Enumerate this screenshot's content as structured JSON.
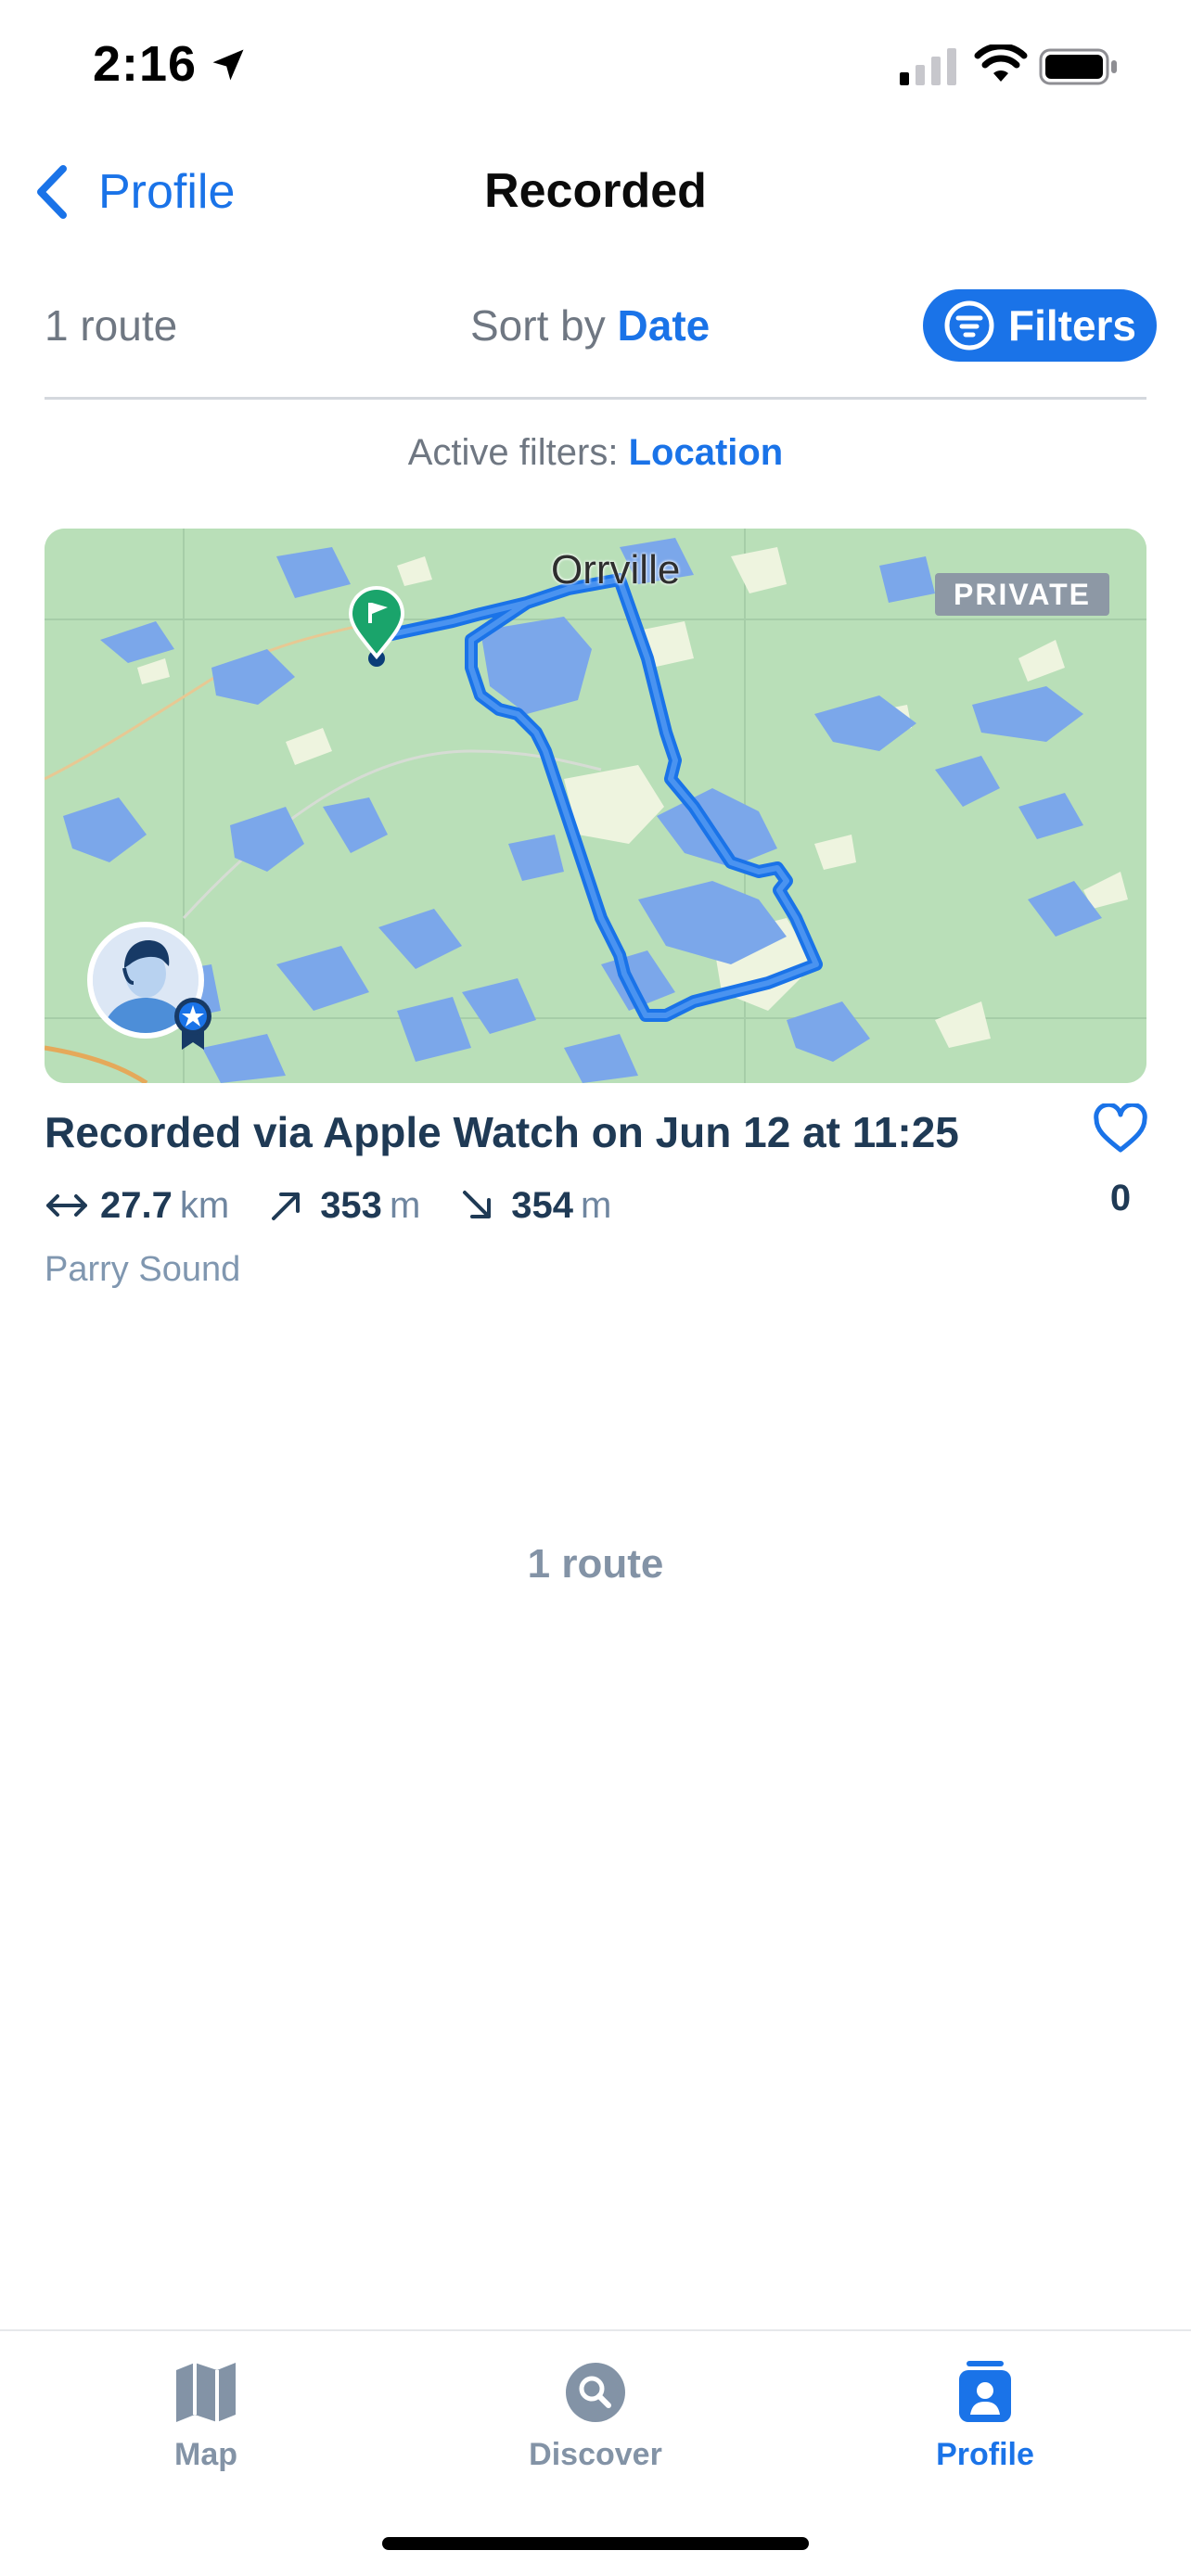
{
  "status_bar": {
    "time": "2:16",
    "icons": [
      "location-arrow-icon",
      "cellular-signal-icon",
      "wifi-icon",
      "battery-icon"
    ]
  },
  "nav": {
    "back_label": "Profile",
    "title": "Recorded"
  },
  "toolbar": {
    "route_count": "1 route",
    "sort_prefix": "Sort by",
    "sort_value": "Date",
    "filters_label": "Filters"
  },
  "active_filters": {
    "prefix": "Active filters:",
    "value": "Location"
  },
  "route": {
    "map_town_label": "Orrville",
    "privacy_badge": "PRIVATE",
    "title": "Recorded via Apple Watch on Jun 12 at 11:25",
    "distance_value": "27.7",
    "distance_unit": "km",
    "ascent_value": "353",
    "ascent_unit": "m",
    "descent_value": "354",
    "descent_unit": "m",
    "location": "Parry Sound",
    "likes": "0"
  },
  "list_footer": {
    "count": "1 route"
  },
  "tabs": [
    {
      "label": "Map",
      "icon": "map-icon",
      "active": false
    },
    {
      "label": "Discover",
      "icon": "search-icon",
      "active": false
    },
    {
      "label": "Profile",
      "icon": "profile-icon",
      "active": true
    }
  ],
  "colors": {
    "accent": "#1a73e8",
    "text_dark": "#1f3a55",
    "text_muted": "#6f7782",
    "map_land": "#b9dfb8",
    "map_water": "#7ba7ea",
    "route_line": "#1a73e8",
    "badge_gray": "#8d98a5"
  }
}
